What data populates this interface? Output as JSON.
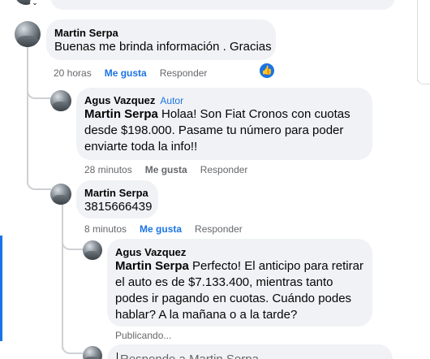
{
  "comments": {
    "c1": {
      "author": "Martin Serpa",
      "text": "Buenas me brinda información . Gracias",
      "time": "20 horas",
      "like_label": "Me gusta",
      "reply_label": "Responder"
    },
    "c2": {
      "author": "Agus Vazquez",
      "badge": "Autor",
      "mention": "Martin Serpa",
      "text": " Holaa! Son Fiat Cronos con cuotas desde $198.000. Pasame tu número para poder enviarte toda la info!!",
      "time": "28 minutos",
      "like_label": "Me gusta",
      "reply_label": "Responder"
    },
    "c3": {
      "author": "Martin Serpa",
      "text": "3815666439",
      "time": "8 minutos",
      "like_label": "Me gusta",
      "reply_label": "Responder"
    },
    "c4": {
      "author": "Agus Vazquez",
      "mention": "Martin Serpa",
      "text": " Perfecto! El anticipo para retirar el auto es de $7.133.400, mientras tanto podes ir pagando en cuotas. Cuándo podes hablar? A la mañana o a la tarde?",
      "status": "Publicando..."
    }
  },
  "reply_box": {
    "placeholder": "Responde a Martin Serpa"
  },
  "colors": {
    "accent": "#1b74e4",
    "bubble": "#f0f2f5",
    "meta": "#65676b"
  }
}
